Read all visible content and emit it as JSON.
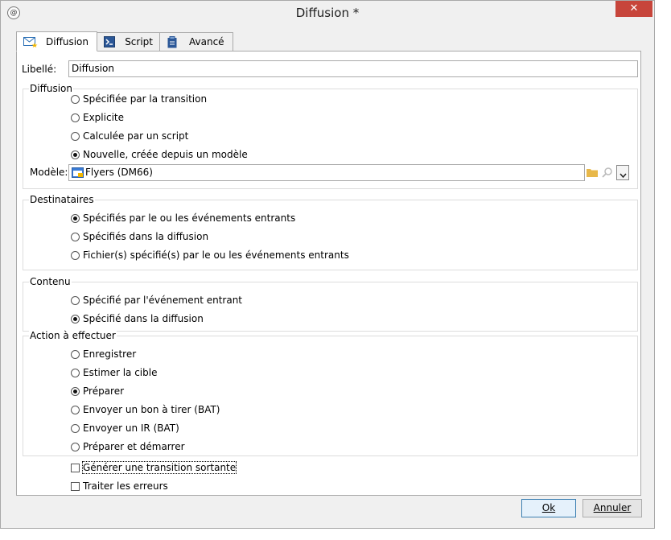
{
  "window": {
    "title": "Diffusion *",
    "close_glyph": "✕"
  },
  "tabs": [
    {
      "label": "Diffusion"
    },
    {
      "label": "Script"
    },
    {
      "label": "Avancé"
    }
  ],
  "libelle": {
    "label": "Libellé:",
    "value": "Diffusion"
  },
  "diffusion_group": {
    "title": "Diffusion",
    "options": [
      {
        "label": "Spécifiée par la transition",
        "selected": false
      },
      {
        "label": "Explicite",
        "selected": false
      },
      {
        "label": "Calculée par un script",
        "selected": false
      },
      {
        "label": "Nouvelle, créée depuis un modèle",
        "selected": true
      }
    ],
    "modele_label": "Modèle:",
    "modele_value": "Flyers (DM66)"
  },
  "destinataires": {
    "title": "Destinataires",
    "options": [
      {
        "label": "Spécifiés par le ou les événements entrants",
        "selected": true
      },
      {
        "label": "Spécifiés dans la diffusion",
        "selected": false
      },
      {
        "label": "Fichier(s) spécifié(s) par le ou les événements entrants",
        "selected": false
      }
    ]
  },
  "contenu": {
    "title": "Contenu",
    "options": [
      {
        "label": "Spécifié par l'événement entrant",
        "selected": false
      },
      {
        "label": "Spécifié dans la diffusion",
        "selected": true
      }
    ]
  },
  "action": {
    "title": "Action à effectuer",
    "options": [
      {
        "label": "Enregistrer",
        "selected": false
      },
      {
        "label": "Estimer la cible",
        "selected": false
      },
      {
        "label": "Préparer",
        "selected": true
      },
      {
        "label": "Envoyer un bon à tirer (BAT)",
        "selected": false
      },
      {
        "label": "Envoyer un IR (BAT)",
        "selected": false
      },
      {
        "label": "Préparer et démarrer",
        "selected": false
      }
    ]
  },
  "checkboxes": [
    {
      "label": "Générer une transition sortante",
      "checked": false
    },
    {
      "label": "Traiter les erreurs",
      "checked": false
    }
  ],
  "buttons": {
    "ok": "Ok",
    "cancel": "Annuler"
  },
  "colors": {
    "accent": "#3c7fb1",
    "close": "#c7453b",
    "folder": "#e8b84a"
  }
}
